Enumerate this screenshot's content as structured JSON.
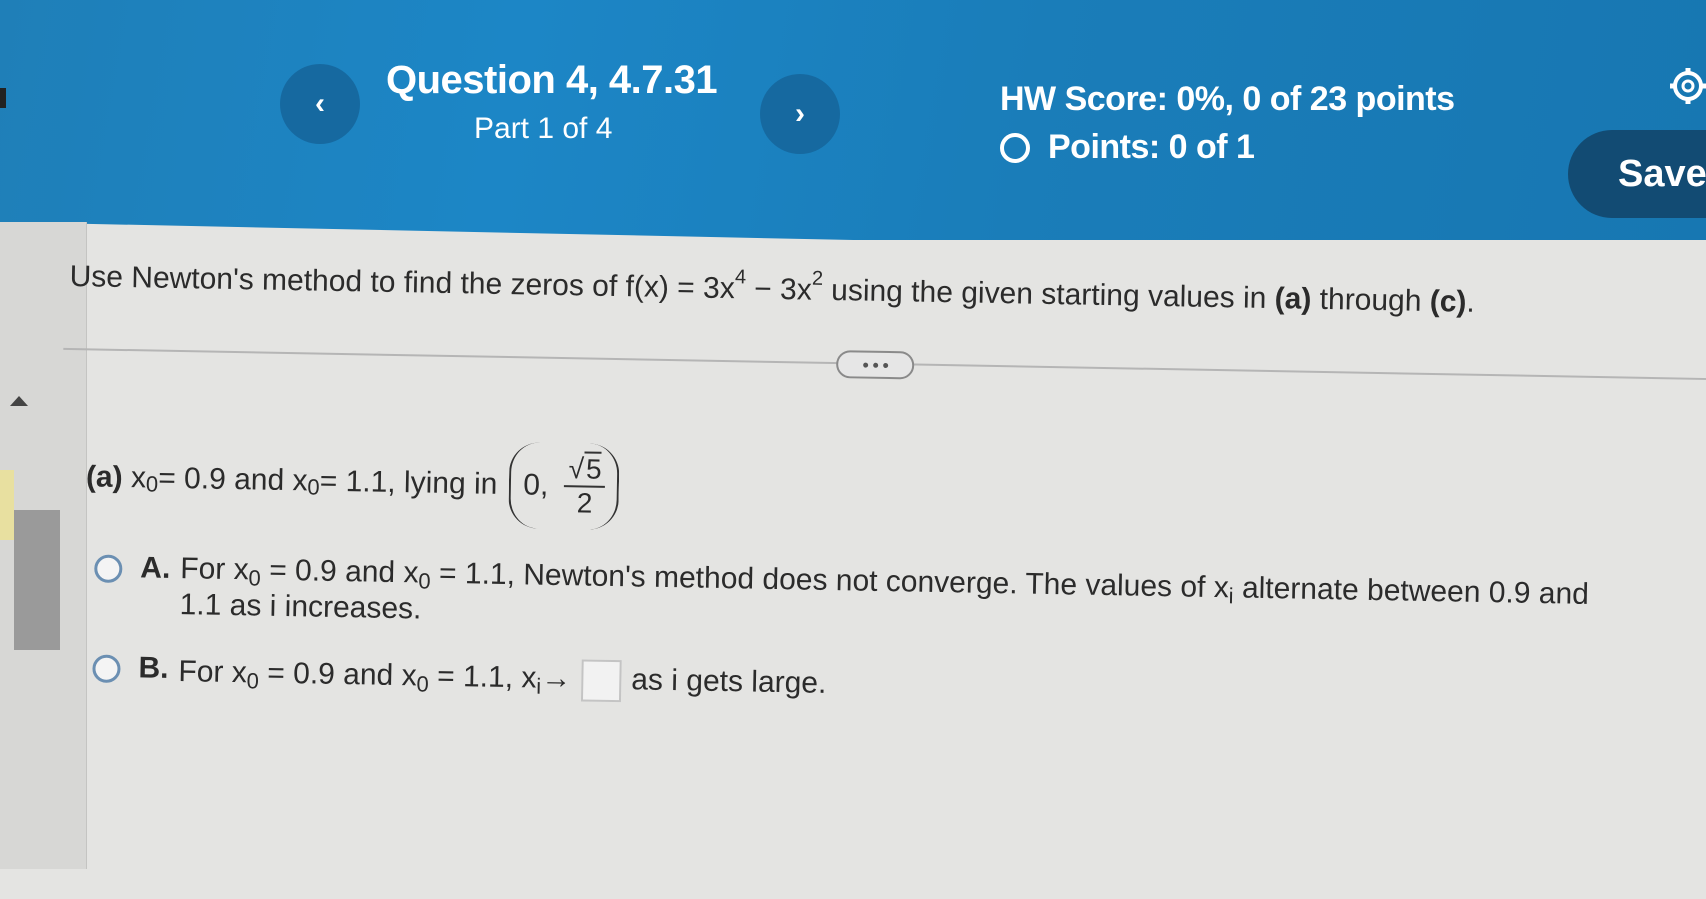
{
  "header": {
    "question_title": "Question 4, 4.7.31",
    "part": "Part 1 of 4",
    "hw_score": "HW Score: 0%, 0 of 23 points",
    "points": "Points: 0 of 1",
    "save_label": "Save",
    "prev_icon": "chevron-left-icon",
    "next_icon": "chevron-right-icon",
    "settings_icon": "gear-icon",
    "color_header": "#1c86c6"
  },
  "problem": {
    "prompt_prefix": "Use Newton's method to find the zeros of f(x) = 3x",
    "exp1": "4",
    "prompt_mid": " − 3x",
    "exp2": "2",
    "prompt_suffix_1": " using the given starting values in ",
    "a_bold": "(a)",
    "through": " through ",
    "c_bold": "(c)",
    "period": "."
  },
  "part_a": {
    "label": "(a)",
    "x0": "x",
    "sub0": "0",
    "text1": " = 0.9 and x",
    "text2": " = 1.1, lying in",
    "interval_left": "0,",
    "sqrt_value": "5",
    "denominator": "2"
  },
  "options": [
    {
      "letter": "A.",
      "text_1": "For x",
      "sub": "0",
      "text_2": " = 0.9 and x",
      "text_3": " = 1.1, Newton's method does not converge. The values of x",
      "sub_i": "i",
      "text_4": " alternate between 0.9 and 1.1 as i increases."
    },
    {
      "letter": "B.",
      "text_1": "For x",
      "sub": "0",
      "text_2": " = 0.9 and x",
      "text_3": " = 1.1, x",
      "sub_i": "i",
      "arrow": "→",
      "text_4": "as i gets large."
    }
  ]
}
